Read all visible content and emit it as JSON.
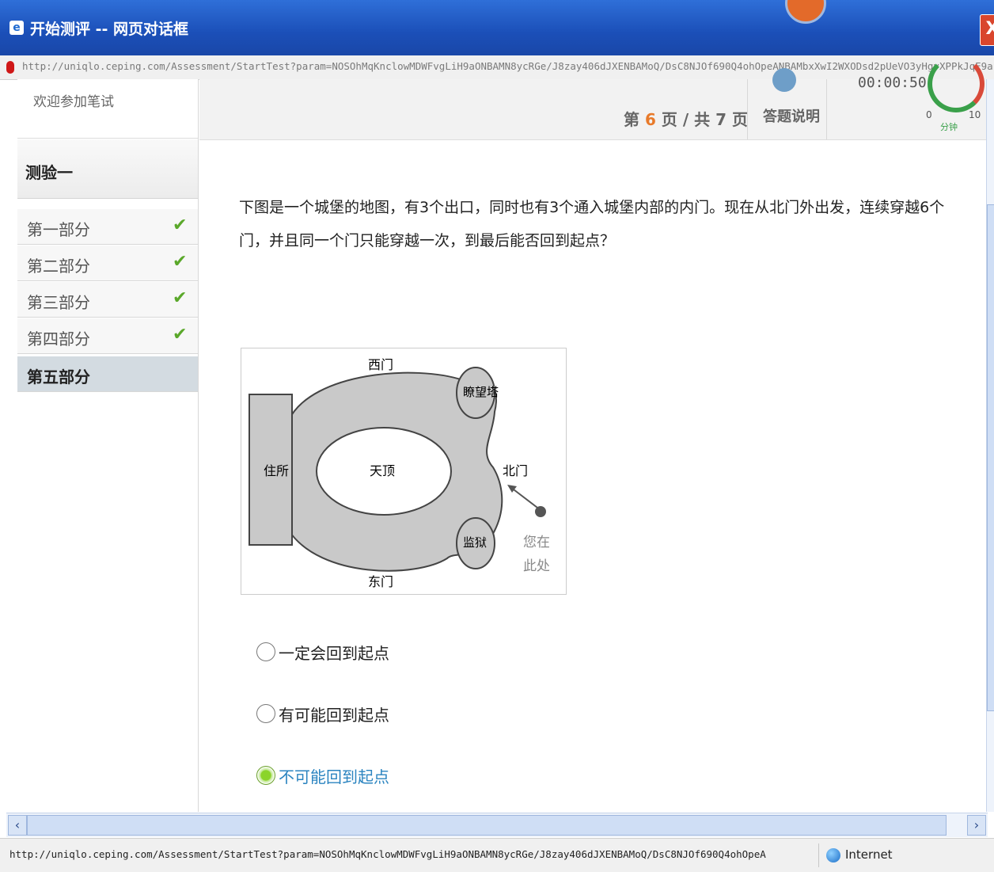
{
  "window": {
    "title": "开始测评 -- 网页对话框",
    "close_glyph": "X",
    "address_url": "http://uniqlo.ceping.com/Assessment/StartTest?param=NOSOhMqKnclowMDWFvgLiH9aONBAMN8ycRGe/J8zay406dJXENBAMoQ/DsC8NJOf690Q4ohOpeANBAMbxXwI2WXODsd2pUeVO3yHgvXPPkJqE9a/",
    "status_url": "http://uniqlo.ceping.com/Assessment/StartTest?param=NOSOhMqKnclowMDWFvgLiH9aONBAMN8ycRGe/J8zay406dJXENBAMoQ/DsC8NJOf690Q4ohOpeA",
    "zone": "Internet"
  },
  "sidebar": {
    "welcome": "欢迎参加笔试",
    "test_title": "测验一",
    "parts": [
      {
        "label": "第一部分",
        "done": true
      },
      {
        "label": "第二部分",
        "done": true
      },
      {
        "label": "第三部分",
        "done": true
      },
      {
        "label": "第四部分",
        "done": true
      },
      {
        "label": "第五部分",
        "done": false
      }
    ],
    "check_glyph": "✔"
  },
  "header": {
    "page_prefix": "第",
    "page_current": "6",
    "page_mid": "页 / 共",
    "page_total": "7",
    "page_suffix": "页",
    "help_label": "答题说明",
    "timer": "00:00:50",
    "gauge_min": "0",
    "gauge_max": "10",
    "gauge_unit": "分钟"
  },
  "question": {
    "text": "下图是一个城堡的地图，有3个出口，同时也有3个通入城堡内部的内门。现在从北门外出发，连续穿越6个门，并且同一个门只能穿越一次，到最后能否回到起点？",
    "map_labels": {
      "west_gate": "西门",
      "east_gate": "东门",
      "north_gate": "北门",
      "tower": "瞭望塔",
      "residence": "住所",
      "courtyard": "天顶",
      "prison": "监狱",
      "you_are_here_1": "您在",
      "you_are_here_2": "此处"
    }
  },
  "options": [
    {
      "label": "一定会回到起点",
      "selected": false
    },
    {
      "label": "有可能回到起点",
      "selected": false
    },
    {
      "label": "不可能回到起点",
      "selected": true
    }
  ],
  "colors": {
    "accent": "#e87a2a",
    "selected_text": "#2b84c0",
    "check": "#5aa82a",
    "titlebar": "#1b4fb8"
  }
}
